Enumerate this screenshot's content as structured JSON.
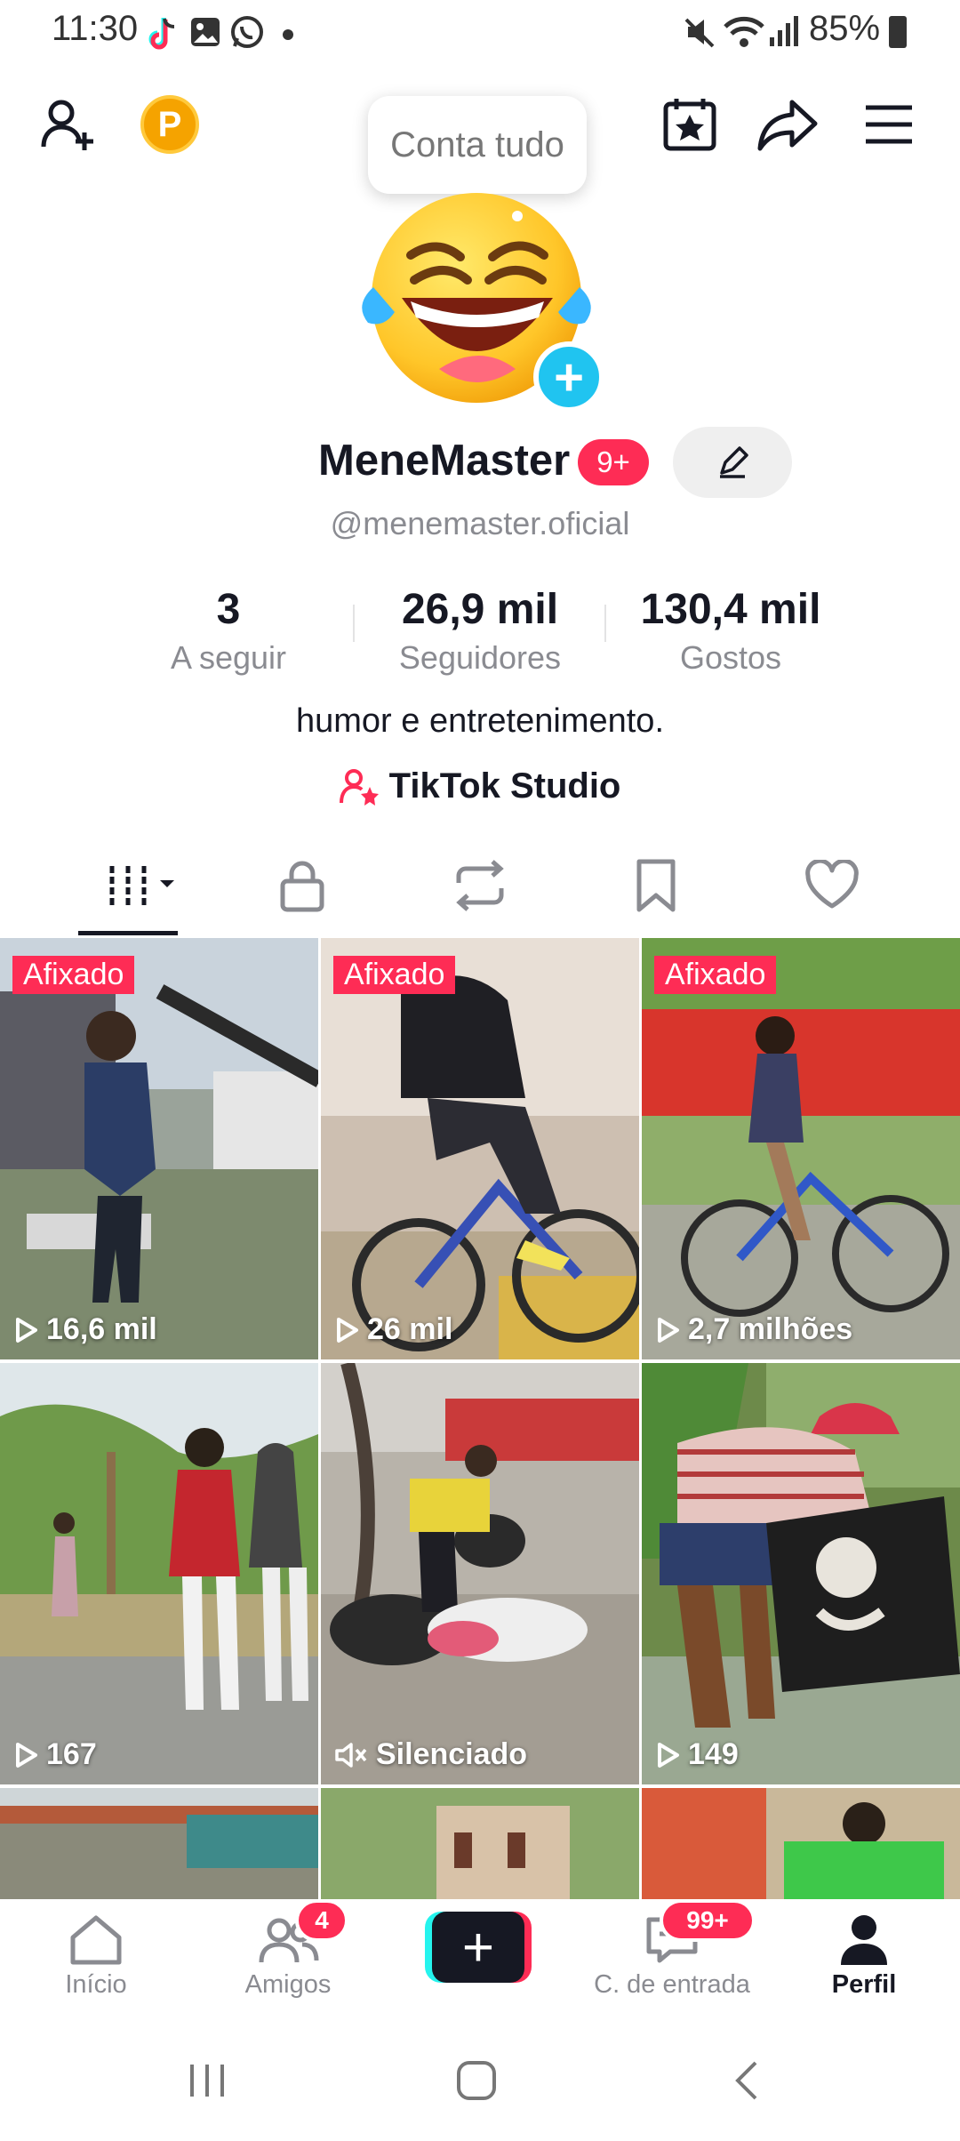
{
  "status": {
    "time": "11:30",
    "battery": "85%"
  },
  "top": {
    "tooltip": "Conta tudo",
    "coin_letter": "P"
  },
  "profile": {
    "name": "MeneMaster",
    "badge": "9+",
    "handle": "@menemaster.oficial",
    "bio": "humor e entretenimento.",
    "studio": "TikTok Studio"
  },
  "stats": [
    {
      "value": "3",
      "label": "A seguir"
    },
    {
      "value": "26,9 mil",
      "label": "Seguidores"
    },
    {
      "value": "130,4 mil",
      "label": "Gostos"
    }
  ],
  "videos": [
    {
      "pinned": "Afixado",
      "views": "16,6 mil",
      "icon": "play-icon"
    },
    {
      "pinned": "Afixado",
      "views": "26 mil",
      "icon": "play-icon"
    },
    {
      "pinned": "Afixado",
      "views": "2,7 milhões",
      "icon": "play-icon"
    },
    {
      "pinned": "",
      "views": "167",
      "icon": "play-icon"
    },
    {
      "pinned": "",
      "views": "Silenciado",
      "icon": "muted-icon"
    },
    {
      "pinned": "",
      "views": "149",
      "icon": "play-icon"
    }
  ],
  "nav": {
    "home": "Início",
    "friends": "Amigos",
    "friends_count": "4",
    "inbox": "C. de entrada",
    "inbox_count": "99+",
    "profile": "Perfil"
  },
  "colors": {
    "accent": "#fe2c55",
    "cyan": "#20c4f0",
    "text": "#161823",
    "muted": "#8a8b91"
  }
}
